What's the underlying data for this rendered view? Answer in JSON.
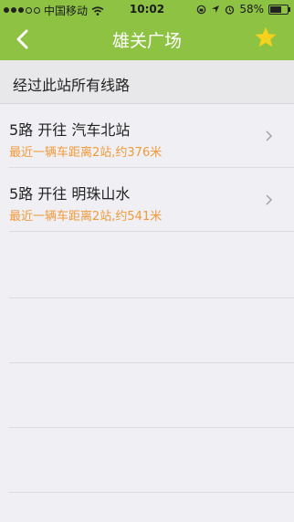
{
  "status": {
    "carrier": "中国移动",
    "time": "10:02",
    "battery": "58%"
  },
  "nav": {
    "title": "雄关广场"
  },
  "section": {
    "title": "经过此站所有线路"
  },
  "routes": [
    {
      "line": "5路 开往 汽车北站",
      "info": "最近一辆车距离2站,约376米"
    },
    {
      "line": "5路 开往 明珠山水",
      "info": "最近一辆车距离2站,约541米"
    }
  ],
  "colors": {
    "header": "#8dc243",
    "accent_orange": "#f19a38",
    "star": "#f3d11c"
  }
}
